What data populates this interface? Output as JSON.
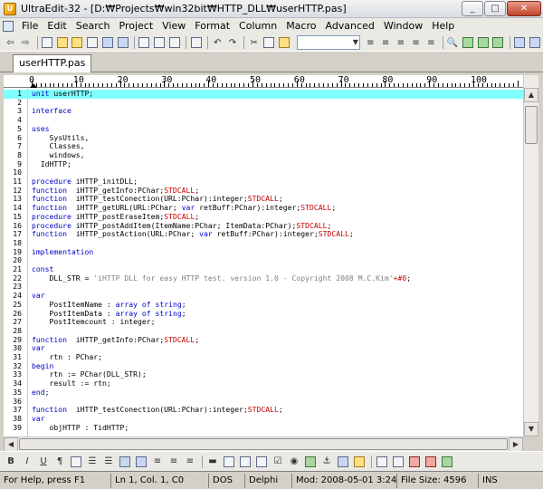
{
  "window": {
    "app_icon_label": "U",
    "title": "UltraEdit-32 - [D:₩Projects₩win32bit₩HTTP_DLL₩userHTTP.pas]",
    "minimize": "_",
    "maximize": "□",
    "close": "✕"
  },
  "menu": [
    "File",
    "Edit",
    "Search",
    "Project",
    "View",
    "Format",
    "Column",
    "Macro",
    "Advanced",
    "Window",
    "Help"
  ],
  "tab": {
    "label": "userHTTP.pas"
  },
  "ruler": {
    "marks": [
      "0",
      "10",
      "20",
      "30",
      "40",
      "50",
      "60",
      "70",
      "80",
      "90",
      "100",
      "110"
    ]
  },
  "editor": {
    "current_line_color": "#80ffff",
    "keyword_color": "#0000c8",
    "directive_color": "#c80000",
    "string_color": "#808080",
    "lines": [
      {
        "n": "1",
        "t": [
          {
            "c": "kw",
            "s": "unit"
          },
          {
            "c": "",
            "s": " userHTTP;"
          }
        ]
      },
      {
        "n": "2",
        "t": []
      },
      {
        "n": "3",
        "t": [
          {
            "c": "kw",
            "s": "interface"
          }
        ]
      },
      {
        "n": "4",
        "t": []
      },
      {
        "n": "5",
        "t": [
          {
            "c": "kw",
            "s": "uses"
          }
        ]
      },
      {
        "n": "6",
        "t": [
          {
            "c": "",
            "s": "    SysUtils,"
          }
        ]
      },
      {
        "n": "7",
        "t": [
          {
            "c": "",
            "s": "    Classes,"
          }
        ]
      },
      {
        "n": "8",
        "t": [
          {
            "c": "",
            "s": "    windows,"
          }
        ]
      },
      {
        "n": "9",
        "t": [
          {
            "c": "",
            "s": "  IdHTTP;"
          }
        ]
      },
      {
        "n": "10",
        "t": []
      },
      {
        "n": "11",
        "t": [
          {
            "c": "kw",
            "s": "procedure"
          },
          {
            "c": "",
            "s": " iHTTP_initDLL;"
          }
        ]
      },
      {
        "n": "12",
        "t": [
          {
            "c": "kw",
            "s": "function"
          },
          {
            "c": "",
            "s": "  iHTTP_getInfo:PChar;"
          },
          {
            "c": "std",
            "s": "STDCALL"
          },
          {
            "c": "",
            "s": ";"
          }
        ]
      },
      {
        "n": "13",
        "t": [
          {
            "c": "kw",
            "s": "function"
          },
          {
            "c": "",
            "s": "  iHTTP_testConection(URL:PChar):integer;"
          },
          {
            "c": "std",
            "s": "STDCALL"
          },
          {
            "c": "",
            "s": ";"
          }
        ]
      },
      {
        "n": "14",
        "t": [
          {
            "c": "kw",
            "s": "function"
          },
          {
            "c": "",
            "s": "  iHTTP_getURL(URL:PChar; "
          },
          {
            "c": "kw",
            "s": "var"
          },
          {
            "c": "",
            "s": " retBuff:PChar):integer;"
          },
          {
            "c": "std",
            "s": "STDCALL"
          },
          {
            "c": "",
            "s": ";"
          }
        ]
      },
      {
        "n": "15",
        "t": [
          {
            "c": "kw",
            "s": "procedure"
          },
          {
            "c": "",
            "s": " iHTTP_postEraseItem;"
          },
          {
            "c": "std",
            "s": "STDCALL"
          },
          {
            "c": "",
            "s": ";"
          }
        ]
      },
      {
        "n": "16",
        "t": [
          {
            "c": "kw",
            "s": "procedure"
          },
          {
            "c": "",
            "s": " iHTTP_postAddItem(ItemName:PChar; ItemData:PChar);"
          },
          {
            "c": "std",
            "s": "STDCALL"
          },
          {
            "c": "",
            "s": ";"
          }
        ]
      },
      {
        "n": "17",
        "t": [
          {
            "c": "kw",
            "s": "function"
          },
          {
            "c": "",
            "s": "  iHTTP_postAction(URL:PChar; "
          },
          {
            "c": "kw",
            "s": "var"
          },
          {
            "c": "",
            "s": " retBuff:PChar):integer;"
          },
          {
            "c": "std",
            "s": "STDCALL"
          },
          {
            "c": "",
            "s": ";"
          }
        ]
      },
      {
        "n": "18",
        "t": []
      },
      {
        "n": "19",
        "t": [
          {
            "c": "kw",
            "s": "implementation"
          }
        ]
      },
      {
        "n": "20",
        "t": []
      },
      {
        "n": "21",
        "t": [
          {
            "c": "kw",
            "s": "const"
          }
        ]
      },
      {
        "n": "22",
        "t": [
          {
            "c": "",
            "s": "    DLL_STR = "
          },
          {
            "c": "str",
            "s": "'iHTTP DLL for easy HTTP test. version 1.0 - Copyright 2008 M.C.Kim'"
          },
          {
            "c": "sym",
            "s": "+#0"
          },
          {
            "c": "",
            "s": ";"
          }
        ]
      },
      {
        "n": "23",
        "t": []
      },
      {
        "n": "24",
        "t": [
          {
            "c": "kw",
            "s": "var"
          }
        ]
      },
      {
        "n": "25",
        "t": [
          {
            "c": "",
            "s": "    PostItemName : "
          },
          {
            "c": "kw",
            "s": "array of string"
          },
          {
            "c": "",
            "s": ";"
          }
        ]
      },
      {
        "n": "26",
        "t": [
          {
            "c": "",
            "s": "    PostItemData : "
          },
          {
            "c": "kw",
            "s": "array of string"
          },
          {
            "c": "",
            "s": ";"
          }
        ]
      },
      {
        "n": "27",
        "t": [
          {
            "c": "",
            "s": "    PostItemcount : integer;"
          }
        ]
      },
      {
        "n": "28",
        "t": []
      },
      {
        "n": "29",
        "t": [
          {
            "c": "kw",
            "s": "function"
          },
          {
            "c": "",
            "s": "  iHTTP_getInfo:PChar;"
          },
          {
            "c": "std",
            "s": "STDCALL"
          },
          {
            "c": "",
            "s": ";"
          }
        ]
      },
      {
        "n": "30",
        "t": [
          {
            "c": "kw",
            "s": "var"
          }
        ]
      },
      {
        "n": "31",
        "t": [
          {
            "c": "",
            "s": "    rtn : PChar;"
          }
        ]
      },
      {
        "n": "32",
        "t": [
          {
            "c": "kw",
            "s": "begin"
          }
        ]
      },
      {
        "n": "33",
        "t": [
          {
            "c": "",
            "s": "    rtn := PChar(DLL_STR);"
          }
        ]
      },
      {
        "n": "34",
        "t": [
          {
            "c": "",
            "s": "    result := rtn;"
          }
        ]
      },
      {
        "n": "35",
        "t": [
          {
            "c": "kw",
            "s": "end"
          },
          {
            "c": "",
            "s": ";"
          }
        ]
      },
      {
        "n": "36",
        "t": []
      },
      {
        "n": "37",
        "t": [
          {
            "c": "kw",
            "s": "function"
          },
          {
            "c": "",
            "s": "  iHTTP_testConection(URL:PChar):integer;"
          },
          {
            "c": "std",
            "s": "STDCALL"
          },
          {
            "c": "",
            "s": ";"
          }
        ]
      },
      {
        "n": "38",
        "t": [
          {
            "c": "kw",
            "s": "var"
          }
        ]
      },
      {
        "n": "39",
        "t": [
          {
            "c": "",
            "s": "    objHTTP : TidHTTP;"
          }
        ]
      }
    ]
  },
  "status": {
    "help": "For Help, press F1",
    "position": "Ln 1, Col. 1, C0",
    "format": "DOS",
    "language": "Delphi",
    "modified": "Mod: 2008-05-01 3:24:58",
    "filesize": "File Size: 4596",
    "mode": "INS"
  }
}
